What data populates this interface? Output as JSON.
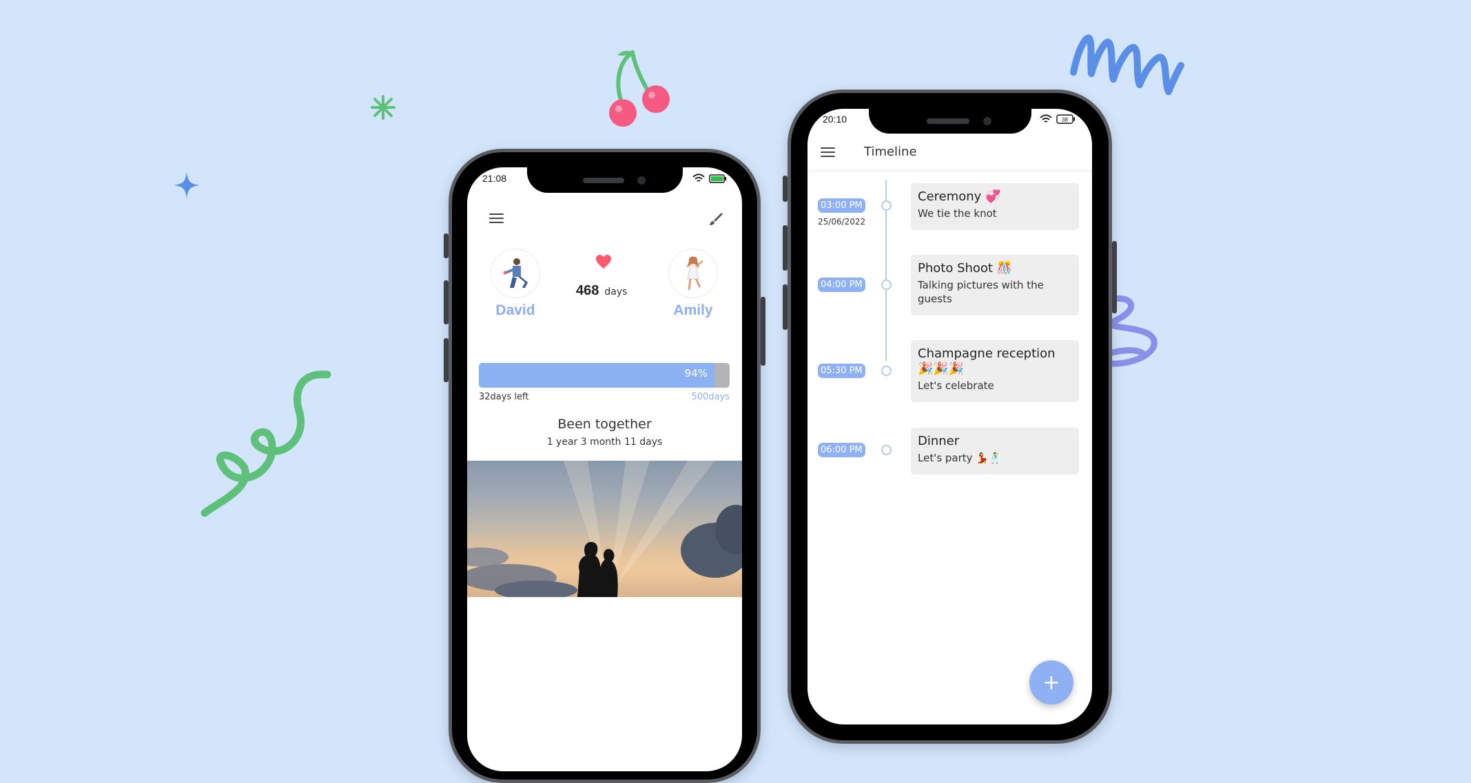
{
  "colors": {
    "background": "#d2e5fb",
    "accent": "#8fb1f4",
    "heart": "#ff5a6e",
    "progress_fill": "#8db2f4",
    "progress_track": "#b4b4b8"
  },
  "phone1": {
    "status": {
      "time": "21:08"
    },
    "header": {
      "menu_icon": "menu-icon",
      "edit_icon": "brush-icon"
    },
    "partner_left": {
      "name": "David",
      "avatar_icon": "man-proposing-avatar"
    },
    "partner_right": {
      "name": "Amily",
      "avatar_icon": "woman-avatar"
    },
    "counter": {
      "icon": "heart-icon",
      "value": "468",
      "unit": "days"
    },
    "progress": {
      "percent_label": "94%",
      "fraction": 0.94,
      "left_label": "32days left",
      "right_label": "500days"
    },
    "together": {
      "title": "Been together",
      "subtitle": "1 year 3 month 11 days"
    },
    "photo": {
      "subject": "couple-silhouette-sunset-photo"
    }
  },
  "phone2": {
    "status": {
      "time": "20:10",
      "battery": "38"
    },
    "appbar": {
      "menu_icon": "menu-icon",
      "title": "Timeline"
    },
    "events": [
      {
        "time": "03:00 PM",
        "date": "25/06/2022",
        "title": "Ceremony 💞",
        "description": "We tie the knot"
      },
      {
        "time": "04:00 PM",
        "title": "Photo Shoot 🎊",
        "description": "Talking pictures with the guests"
      },
      {
        "time": "05:30 PM",
        "title": "Champagne reception 🎉🎉🎉",
        "description": "Let's celebrate"
      },
      {
        "time": "06:00 PM",
        "title": "Dinner",
        "description": "Let's party 💃🕺"
      }
    ],
    "fab": {
      "label": "+"
    }
  }
}
